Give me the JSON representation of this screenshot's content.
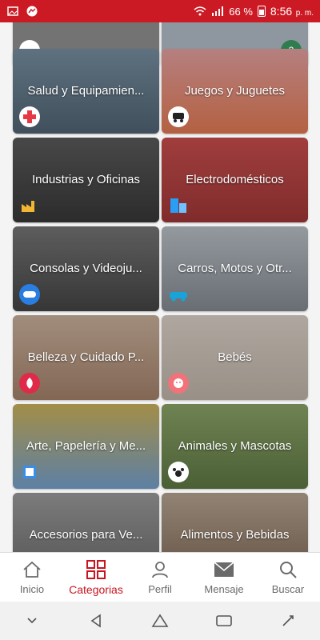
{
  "status_bar": {
    "battery_percent": "66 %",
    "time": "8:56",
    "ampm": "p. m.",
    "bg_color": "#cc1a24",
    "icons": [
      "image-icon",
      "messenger-icon",
      "wifi-icon",
      "signal-icon",
      "battery-icon"
    ]
  },
  "categories": [
    {
      "label": "",
      "icon": "unknown-icon",
      "badge_color": "#ffffff"
    },
    {
      "label": "",
      "icon": "unknown-icon",
      "badge_color": "#ffffff"
    },
    {
      "label": "Salud y Equipamien...",
      "icon": "medical-cross-icon",
      "badge_color": "#e63946"
    },
    {
      "label": "Juegos y Juguetes",
      "icon": "train-icon",
      "badge_color": "#222222"
    },
    {
      "label": "Industrias y Oficinas",
      "icon": "factory-icon",
      "badge_color": "#f2b632"
    },
    {
      "label": "Electrodomésticos",
      "icon": "appliance-icon",
      "badge_color": "#2a9df4"
    },
    {
      "label": "Consolas y Videoju...",
      "icon": "gamepad-icon",
      "badge_color": "#2a7de1"
    },
    {
      "label": "Carros, Motos y Otr...",
      "icon": "car-icon",
      "badge_color": "#19a3d8"
    },
    {
      "label": "Belleza y Cuidado P...",
      "icon": "beauty-icon",
      "badge_color": "#e02a4a"
    },
    {
      "label": "Bebés",
      "icon": "baby-icon",
      "badge_color": "#f2727a"
    },
    {
      "label": "Arte, Papelería y Me...",
      "icon": "stationery-icon",
      "badge_color": "#3b8ee8"
    },
    {
      "label": "Animales y Mascotas",
      "icon": "pet-icon",
      "badge_color": "#222222"
    },
    {
      "label": "Accesorios para Ve...",
      "icon": "car-parts-icon",
      "badge_color": "#999999"
    },
    {
      "label": "Alimentos y Bebidas",
      "icon": "food-icon",
      "badge_color": "#999999"
    }
  ],
  "bottom_nav": {
    "items": [
      {
        "label": "Inicio",
        "icon": "home-icon",
        "active": false
      },
      {
        "label": "Categorias",
        "icon": "grid-icon",
        "active": true
      },
      {
        "label": "Perfil",
        "icon": "person-icon",
        "active": false
      },
      {
        "label": "Mensaje",
        "icon": "mail-icon",
        "active": false
      },
      {
        "label": "Buscar",
        "icon": "search-icon",
        "active": false
      }
    ],
    "active_color": "#c8151f"
  },
  "system_nav": {
    "icons": [
      "hide-keyboard-icon",
      "back-icon",
      "home-icon",
      "recent-apps-icon",
      "rotate-icon"
    ]
  }
}
